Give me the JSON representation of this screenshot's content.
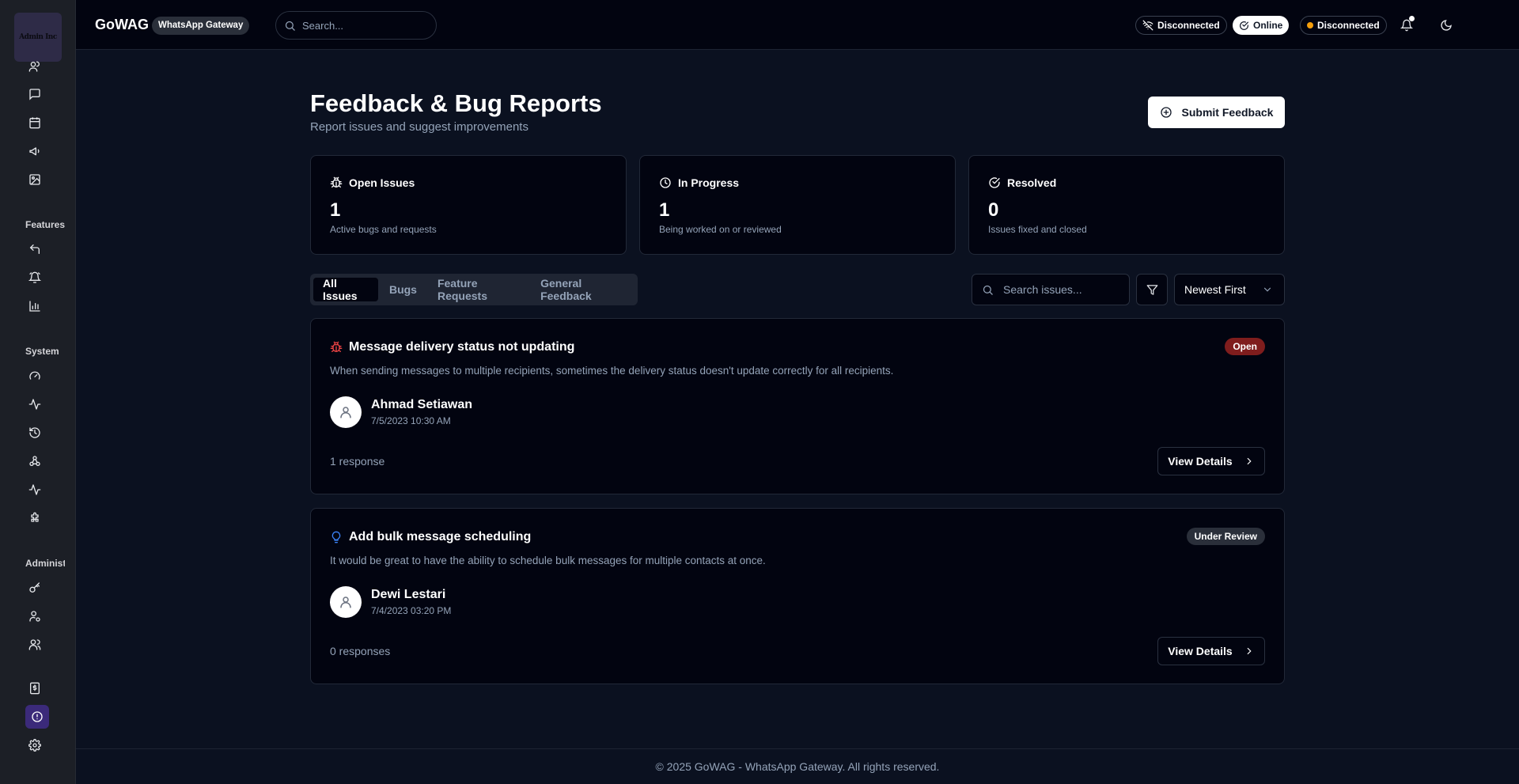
{
  "sidebar": {
    "logo_text": "Admin Inc",
    "sections": {
      "features": "Features",
      "system": "System",
      "administration": "Administ"
    }
  },
  "header": {
    "brand": "GoWAG",
    "brand_badge": "WhatsApp Gateway",
    "search_placeholder": "Search...",
    "status_1": "Disconnected",
    "status_2": "Online",
    "status_3": "Disconnected"
  },
  "page": {
    "title": "Feedback & Bug Reports",
    "subtitle": "Report issues and suggest improvements",
    "submit_label": "Submit Feedback"
  },
  "stats": [
    {
      "label": "Open Issues",
      "value": "1",
      "desc": "Active bugs and requests"
    },
    {
      "label": "In Progress",
      "value": "1",
      "desc": "Being worked on or reviewed"
    },
    {
      "label": "Resolved",
      "value": "0",
      "desc": "Issues fixed and closed"
    }
  ],
  "tabs": [
    "All Issues",
    "Bugs",
    "Feature Requests",
    "General Feedback"
  ],
  "filters": {
    "search_placeholder": "Search issues...",
    "sort": "Newest First"
  },
  "issues": [
    {
      "title": "Message delivery status not updating",
      "desc": "When sending messages to multiple recipients, sometimes the delivery status doesn't update correctly for all recipients.",
      "status": "Open",
      "author": "Ahmad Setiawan",
      "date": "7/5/2023 10:30 AM",
      "responses": "1 response",
      "action": "View Details",
      "type_icon": "bug-icon",
      "type_color": "#ef4444"
    },
    {
      "title": "Add bulk message scheduling",
      "desc": "It would be great to have the ability to schedule bulk messages for multiple contacts at once.",
      "status": "Under Review",
      "author": "Dewi Lestari",
      "date": "7/4/2023 03:20 PM",
      "responses": "0 responses",
      "action": "View Details",
      "type_icon": "lightbulb-icon",
      "type_color": "#3b82f6"
    }
  ],
  "footer": "© 2025 GoWAG - WhatsApp Gateway. All rights reserved."
}
